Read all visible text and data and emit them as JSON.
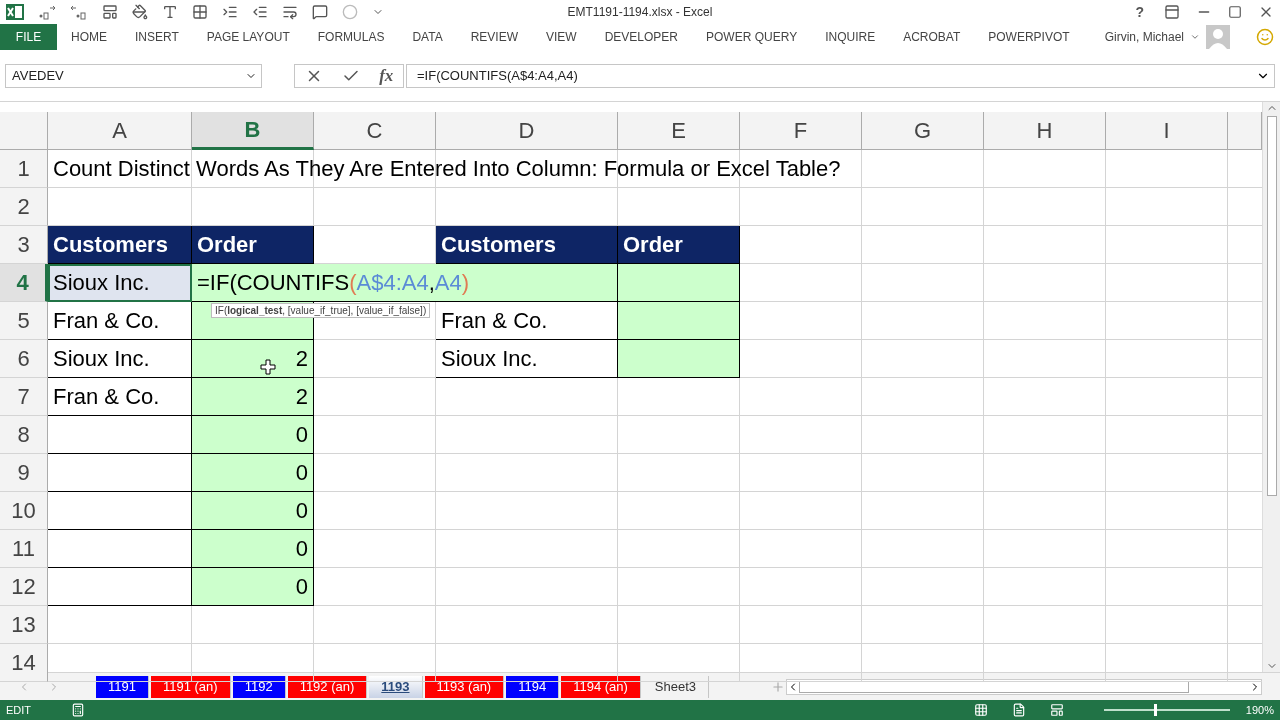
{
  "window": {
    "title": "EMT1191-1194.xlsx - Excel",
    "help": "?"
  },
  "ribbon_tabs": [
    {
      "label": "FILE",
      "kind": "file"
    },
    {
      "label": "HOME",
      "kind": "tab"
    },
    {
      "label": "INSERT",
      "kind": "tab"
    },
    {
      "label": "PAGE LAYOUT",
      "kind": "tab"
    },
    {
      "label": "FORMULAS",
      "kind": "tab"
    },
    {
      "label": "DATA",
      "kind": "tab"
    },
    {
      "label": "REVIEW",
      "kind": "tab"
    },
    {
      "label": "VIEW",
      "kind": "tab"
    },
    {
      "label": "DEVELOPER",
      "kind": "tab"
    },
    {
      "label": "POWER QUERY",
      "kind": "tab"
    },
    {
      "label": "INQUIRE",
      "kind": "tab"
    },
    {
      "label": "ACROBAT",
      "kind": "tab"
    },
    {
      "label": "POWERPIVOT",
      "kind": "tab"
    }
  ],
  "user": {
    "name": "Girvin, Michael"
  },
  "name_box": {
    "value": "AVEDEV"
  },
  "formula_bar": {
    "function_button": "fx",
    "value": "=IF(COUNTIFS(A$4:A4,A4)"
  },
  "columns": [
    {
      "label": "A",
      "selected": false
    },
    {
      "label": "B",
      "selected": true
    },
    {
      "label": "C",
      "selected": false
    },
    {
      "label": "D",
      "selected": false
    },
    {
      "label": "E",
      "selected": false
    },
    {
      "label": "F",
      "selected": false
    },
    {
      "label": "G",
      "selected": false
    },
    {
      "label": "H",
      "selected": false
    },
    {
      "label": "I",
      "selected": false
    }
  ],
  "rows": [
    {
      "label": "1",
      "selected": false,
      "cells": [
        {
          "kind": "title",
          "text": "Count Distinct Words As They Are Entered Into Column: Formula or Excel Table?"
        },
        {
          "kind": "overflow"
        },
        {
          "kind": "overflow"
        },
        {
          "kind": "overflow"
        },
        {
          "kind": "overflow"
        },
        {
          "kind": "overflow"
        },
        {
          "kind": "overflow"
        }
      ]
    },
    {
      "label": "2",
      "selected": false,
      "cells": []
    },
    {
      "label": "3",
      "selected": false,
      "cells": [
        {
          "kind": "header",
          "text": "Customers"
        },
        {
          "kind": "header",
          "text": "Order"
        },
        {
          "kind": "blank"
        },
        {
          "kind": "header",
          "text": "Customers"
        },
        {
          "kind": "header",
          "text": "Order"
        }
      ]
    },
    {
      "label": "4",
      "selected": true,
      "cells": [
        {
          "kind": "active",
          "text": "Sioux Inc."
        },
        {
          "kind": "formula",
          "parts": [
            {
              "text": "=IF(COUNTIFS"
            },
            {
              "text": "(",
              "color": "#e07b53"
            },
            {
              "text": "A$4:A4",
              "color": "#5b8bd6"
            },
            {
              "text": ","
            },
            {
              "text": "A4",
              "color": "#5b8bd6"
            },
            {
              "text": ")",
              "color": "#e07b53"
            }
          ]
        },
        {
          "kind": "overflow"
        },
        {
          "kind": "overflow"
        },
        {
          "kind": "calc"
        }
      ]
    },
    {
      "label": "5",
      "selected": false,
      "cells": [
        {
          "kind": "table",
          "text": "Fran & Co."
        },
        {
          "kind": "calc"
        },
        {
          "kind": "blank"
        },
        {
          "kind": "table",
          "text": "Fran & Co."
        },
        {
          "kind": "calc"
        }
      ]
    },
    {
      "label": "6",
      "selected": false,
      "cells": [
        {
          "kind": "table",
          "text": "Sioux Inc."
        },
        {
          "kind": "calc",
          "text": "2"
        },
        {
          "kind": "blank"
        },
        {
          "kind": "table",
          "text": "Sioux Inc."
        },
        {
          "kind": "calc"
        }
      ]
    },
    {
      "label": "7",
      "selected": false,
      "cells": [
        {
          "kind": "table",
          "text": "Fran & Co."
        },
        {
          "kind": "calc",
          "text": "2"
        }
      ]
    },
    {
      "label": "8",
      "selected": false,
      "cells": [
        {
          "kind": "table"
        },
        {
          "kind": "calc",
          "text": "0"
        }
      ]
    },
    {
      "label": "9",
      "selected": false,
      "cells": [
        {
          "kind": "table"
        },
        {
          "kind": "calc",
          "text": "0"
        }
      ]
    },
    {
      "label": "10",
      "selected": false,
      "cells": [
        {
          "kind": "table"
        },
        {
          "kind": "calc",
          "text": "0"
        }
      ]
    },
    {
      "label": "11",
      "selected": false,
      "cells": [
        {
          "kind": "table"
        },
        {
          "kind": "calc",
          "text": "0"
        }
      ]
    },
    {
      "label": "12",
      "selected": false,
      "cells": [
        {
          "kind": "table"
        },
        {
          "kind": "calc",
          "text": "0"
        }
      ]
    },
    {
      "label": "13",
      "selected": false,
      "cells": []
    },
    {
      "label": "14",
      "selected": false,
      "cells": []
    }
  ],
  "tooltip": "IF(**logical_test**, [value_if_true], [value_if_false])",
  "sheet_tabs": [
    {
      "label": "1191",
      "selected": false,
      "color": "#0000ff"
    },
    {
      "label": "1191 (an)",
      "selected": false,
      "color": "#ff0000"
    },
    {
      "label": "1192",
      "selected": false,
      "color": "#0000ff"
    },
    {
      "label": "1192 (an)",
      "selected": false,
      "color": "#ff0000"
    },
    {
      "label": "1193",
      "selected": true
    },
    {
      "label": "1193 (an)",
      "selected": false,
      "color": "#ff0000"
    },
    {
      "label": "1194",
      "selected": false,
      "color": "#0000ff"
    },
    {
      "label": "1194 (an)",
      "selected": false,
      "color": "#ff0000"
    },
    {
      "label": "Sheet3",
      "selected": false
    }
  ],
  "status_bar": {
    "mode": "EDIT",
    "zoom": {
      "reading": "190%",
      "level": 0.4
    }
  }
}
